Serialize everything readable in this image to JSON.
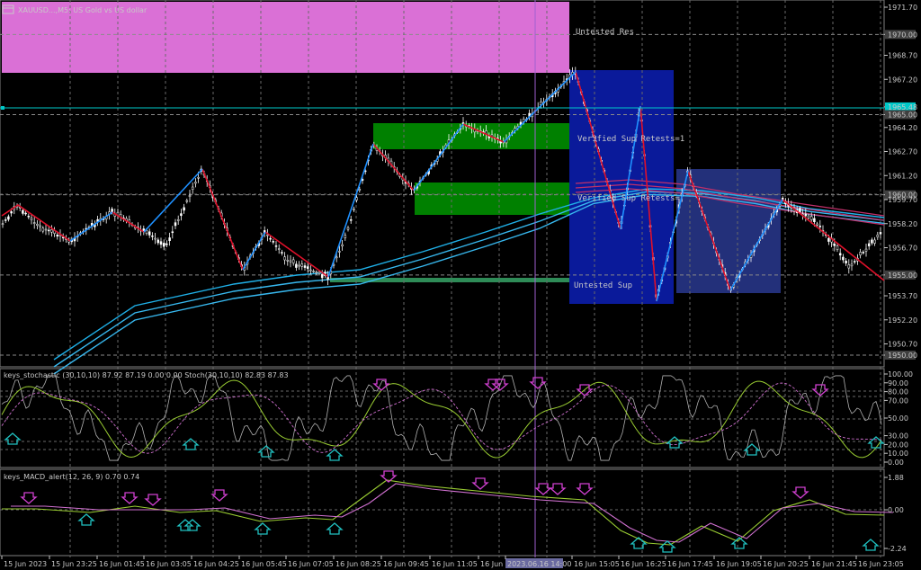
{
  "window": {
    "symbol_title": "XAUUSD...,M5:  US Gold vs US dollar",
    "icon": "chart-window-icon"
  },
  "main_chart": {
    "price_axis": [
      {
        "label": "1971.70",
        "value": 1971.7
      },
      {
        "label": "1970.00",
        "value": 1970.0,
        "boxed": true
      },
      {
        "label": "1968.70",
        "value": 1968.7
      },
      {
        "label": "1967.20",
        "value": 1967.2
      },
      {
        "label": "1965.48",
        "value": 1965.48,
        "current": true
      },
      {
        "label": "1965.00",
        "value": 1965.0,
        "boxed": true
      },
      {
        "label": "1964.20",
        "value": 1964.2
      },
      {
        "label": "1962.70",
        "value": 1962.7
      },
      {
        "label": "1961.20",
        "value": 1961.2
      },
      {
        "label": "1960.00",
        "value": 1960.0,
        "boxed": true
      },
      {
        "label": "1959.70",
        "value": 1959.7
      },
      {
        "label": "1958.20",
        "value": 1958.2
      },
      {
        "label": "1956.70",
        "value": 1956.7
      },
      {
        "label": "1955.00",
        "value": 1955.0,
        "boxed": true
      },
      {
        "label": "1953.70",
        "value": 1953.7
      },
      {
        "label": "1952.20",
        "value": 1952.2
      },
      {
        "label": "1950.70",
        "value": 1950.7
      },
      {
        "label": "1950.00",
        "value": 1950.0,
        "boxed": true
      }
    ],
    "zone_labels": {
      "untested_res": "Untested Res",
      "verified_sup_1": "Verified Sup  Retests=1",
      "verified_sup_2": "Verified Sup  Retests=",
      "untested_sup": "Untested Sup"
    },
    "colors": {
      "resistance_zone": "#da70d6",
      "support_zone_green": "#008000",
      "verified_zone_blue": "#0a1a9a",
      "verified_zone_blue2": "#23307a",
      "untested_sup_line": "#2e8b57",
      "zigzag": "#e0102a",
      "zigzag_up": "#1e90ff",
      "bid_line": "#00c8c8",
      "ma_ribbon": "#1fb0e8",
      "ma_ribbon_red": "#c0306a",
      "candle": "#ffffff",
      "grid": "#808080"
    }
  },
  "stochastic": {
    "title": "keys_stochastic (30,10,10) 87.92 87.19 0.00 0.00 Stoch(30,10,10) 82.83 87.83",
    "axis": [
      {
        "label": "100.00",
        "value": 100
      },
      {
        "label": "90.00",
        "value": 90
      },
      {
        "label": "80.00",
        "value": 80
      },
      {
        "label": "70.00",
        "value": 70
      },
      {
        "label": "50.00",
        "value": 50
      },
      {
        "label": "30.00",
        "value": 30
      },
      {
        "label": "20.00",
        "value": 20
      },
      {
        "label": "10.00",
        "value": 10
      },
      {
        "label": "0.00",
        "value": 0
      }
    ]
  },
  "macd": {
    "title": "keys_MACD_alert(12, 26, 9) 0.70 0.74",
    "axis": [
      {
        "label": "1.88",
        "value": 1.88
      },
      {
        "label": "0.00",
        "value": 0
      },
      {
        "label": "-2.24",
        "value": -2.24
      }
    ]
  },
  "time_axis": [
    "15 Jun 2023",
    "15 Jun 23:25",
    "16 Jun 01:45",
    "16 Jun 03:05",
    "16 Jun 04:25",
    "16 Jun 05:45",
    "16 Jun 07:05",
    "16 Jun 08:25",
    "16 Jun 09:45",
    "16 Jun 11:05",
    "16 Jun 12:",
    "2023.06.16 14:00",
    "16 Jun 15:05",
    "16 Jun 16:25",
    "16 Jun 17:45",
    "16 Jun 19:05",
    "16 Jun 20:25",
    "16 Jun 21:45",
    "16 Jun 23:05"
  ]
}
